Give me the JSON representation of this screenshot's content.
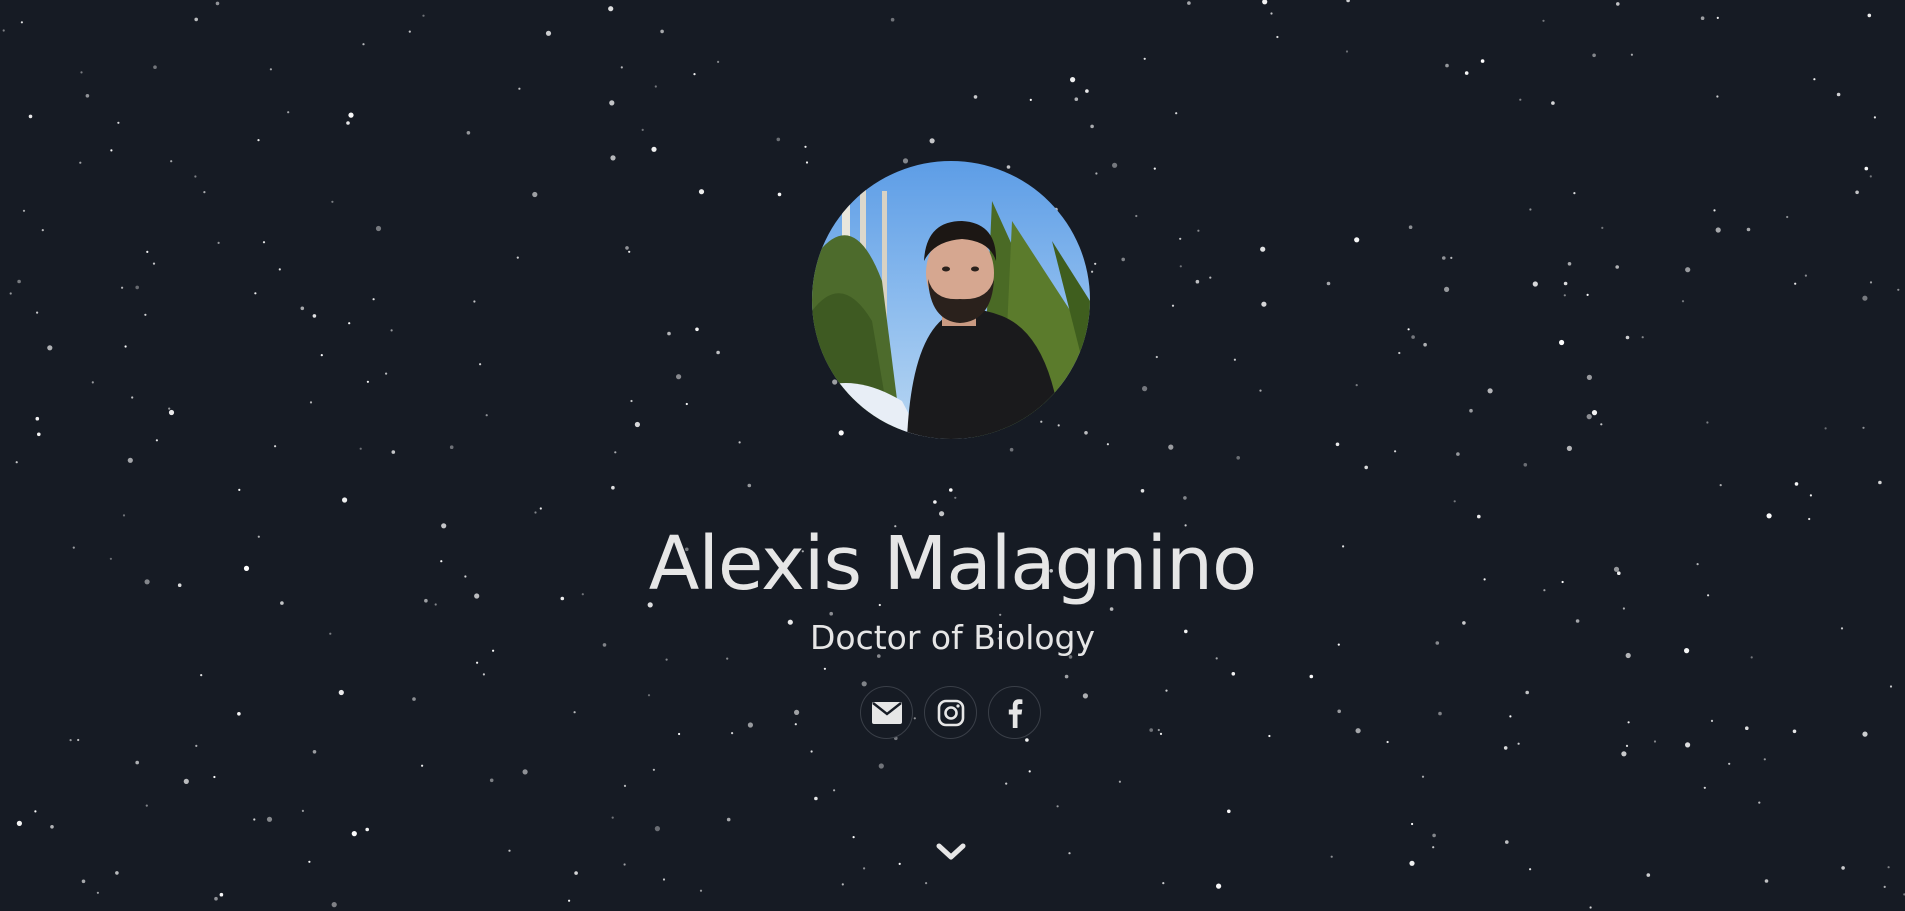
{
  "profile": {
    "name": "Alexis Malagnino",
    "title": "Doctor of Biology"
  },
  "social": [
    {
      "icon": "envelope-icon",
      "name": "email"
    },
    {
      "icon": "instagram-icon",
      "name": "instagram"
    },
    {
      "icon": "facebook-icon",
      "name": "facebook"
    }
  ],
  "colors": {
    "background": "#161b24",
    "text": "#e6e6e6",
    "icon_border": "#3a3f48"
  }
}
